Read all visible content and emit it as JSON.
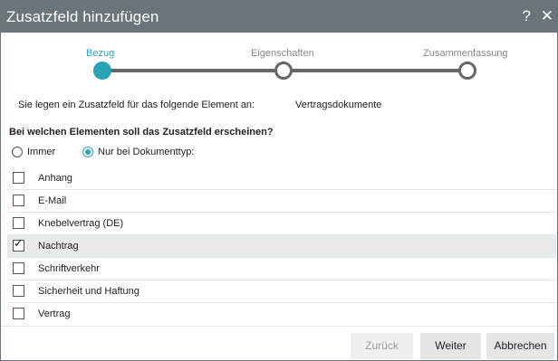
{
  "dialog": {
    "title": "Zusatzfeld hinzufügen",
    "help_icon": "?",
    "close_icon": "✕"
  },
  "stepper": {
    "steps": [
      {
        "label": "Bezug",
        "state": "active"
      },
      {
        "label": "Eigenschaften",
        "state": "inactive"
      },
      {
        "label": "Zusammenfassung",
        "state": "inactive"
      }
    ],
    "accent_color": "#2aa3b5"
  },
  "info": {
    "label": "Sie legen ein Zusatzfeld für das folgende Element an:",
    "value": "Vertragsdokumente"
  },
  "question": "Bei welchen Elementen soll das Zusatzfeld erscheinen?",
  "scope": {
    "options": [
      {
        "label": "Immer",
        "checked": false
      },
      {
        "label": "Nur bei Dokumenttyp:",
        "checked": true
      }
    ]
  },
  "doc_types": [
    {
      "label": "Anhang",
      "checked": false
    },
    {
      "label": "E-Mail",
      "checked": false
    },
    {
      "label": "Knebelvertrag (DE)",
      "checked": false
    },
    {
      "label": "Nachtrag",
      "checked": true
    },
    {
      "label": "Schriftverkehr",
      "checked": false
    },
    {
      "label": "Sicherheit und Haftung",
      "checked": false
    },
    {
      "label": "Vertrag",
      "checked": false
    }
  ],
  "buttons": {
    "back": "Zurück",
    "next": "Weiter",
    "cancel": "Abbrechen"
  }
}
